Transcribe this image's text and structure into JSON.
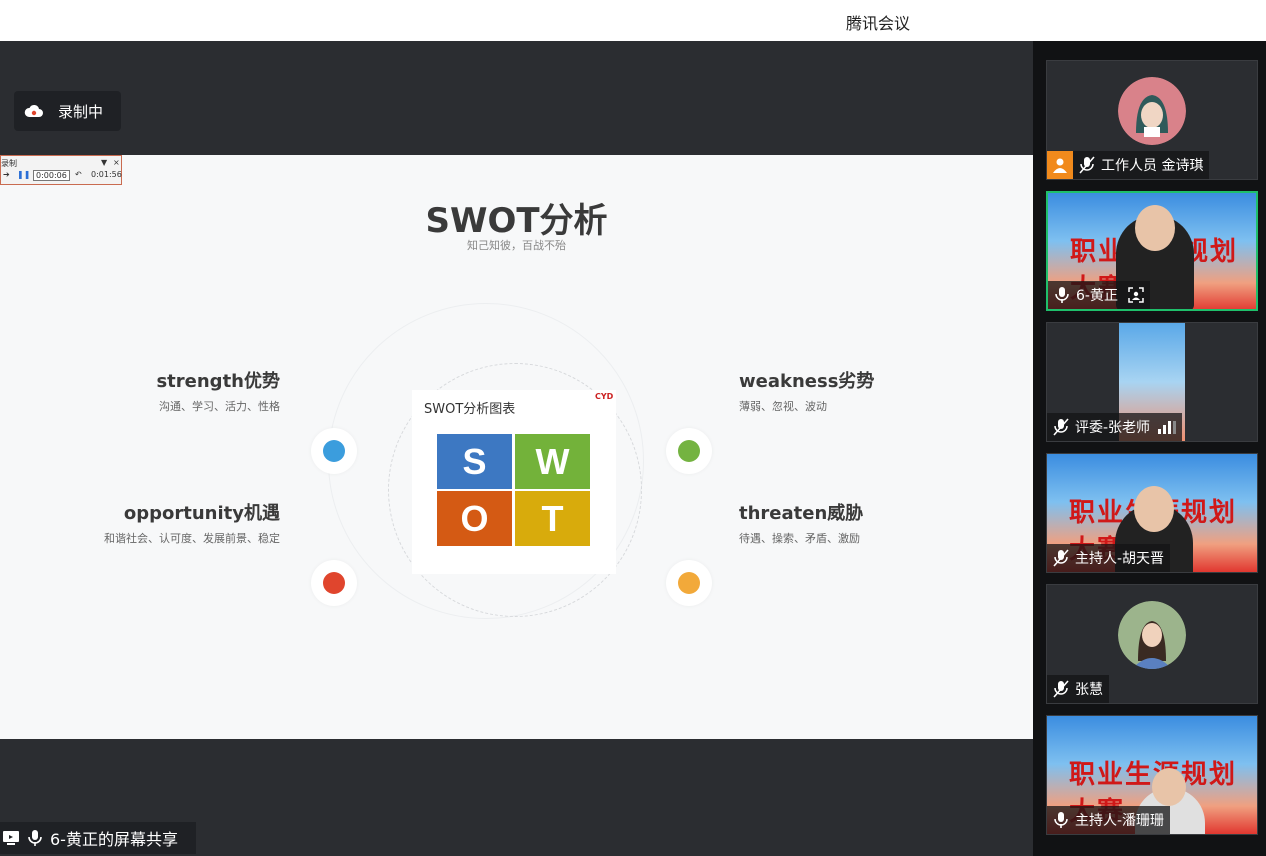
{
  "app": {
    "title": "腾讯会议"
  },
  "recording": {
    "label": "录制中",
    "icon": "cloud-record-icon"
  },
  "player": {
    "label": "录制",
    "current_time": "0:00:06",
    "total_time": "0:01:56"
  },
  "slide": {
    "title": "SWOT分析",
    "subtitle": "知己知彼，百战不殆",
    "center_card": {
      "title": "SWOT分析图表",
      "logo": "CYD",
      "letters": [
        "S",
        "W",
        "O",
        "T"
      ]
    },
    "quadrants": [
      {
        "title": "strength优势",
        "desc": "沟通、学习、活力、性格",
        "color": "#3b9ddd"
      },
      {
        "title": "weakness劣势",
        "desc": "薄弱、忽视、波动",
        "color": "#74b341"
      },
      {
        "title": "opportunity机遇",
        "desc": "和谐社会、认可度、发展前景、稳定",
        "color": "#e0452d"
      },
      {
        "title": "threaten威胁",
        "desc": "待遇、操索、矛盾、激励",
        "color": "#f2a93a"
      }
    ]
  },
  "share": {
    "label": "6-黄正的屏幕共享"
  },
  "participants": [
    {
      "name": "工作人员 金诗琪",
      "type": "avatar",
      "muted": true
    },
    {
      "name": "6-黄正",
      "type": "video",
      "muted": false,
      "active": true,
      "banner": "职业生涯规划大赛"
    },
    {
      "name": "评委-张老师",
      "type": "video-narrow",
      "muted": true
    },
    {
      "name": "主持人-胡天晋",
      "type": "video",
      "muted": true,
      "banner": "职业生涯规划大赛"
    },
    {
      "name": "张慧",
      "type": "avatar",
      "muted": true
    },
    {
      "name": "主持人-潘珊珊",
      "type": "video",
      "muted": false,
      "banner": "职业生涯规划大赛"
    }
  ],
  "colors": {
    "accent_active": "#1fbf6b",
    "stage_bg": "#2b2d31",
    "sidebar_bg": "#111214"
  }
}
